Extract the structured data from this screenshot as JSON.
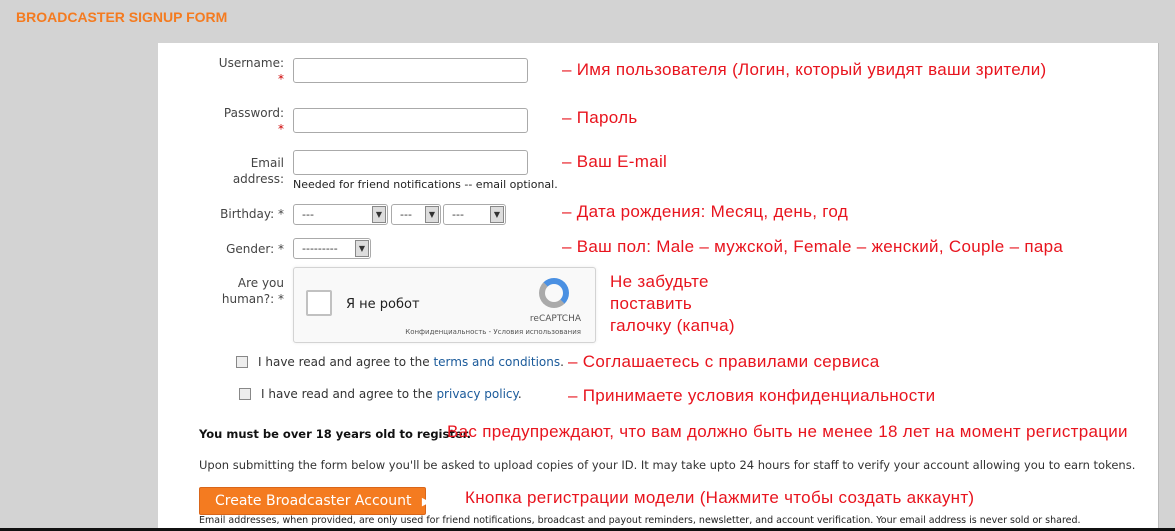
{
  "header": {
    "title": "BROADCASTER SIGNUP FORM"
  },
  "form": {
    "username": {
      "label": "Username:",
      "req": "*",
      "value": ""
    },
    "password": {
      "label": "Password:",
      "req": "*",
      "value": ""
    },
    "email": {
      "label1": "Email",
      "label2": "address:",
      "value": "",
      "hint": "Needed for friend notifications -- email optional."
    },
    "birthday": {
      "label": "Birthday: *",
      "month": "---",
      "day": "---",
      "year": "---"
    },
    "gender": {
      "label": "Gender: *",
      "value": "---------"
    },
    "human": {
      "label1": "Are you",
      "label2": "human?: *"
    },
    "captcha": {
      "text": "Я не робот",
      "brand": "reCAPTCHA",
      "links": "Конфиденциальность - Условия использования"
    },
    "terms": {
      "prefix": "I have read and agree to the ",
      "link": "terms and conditions",
      "suffix": "."
    },
    "privacy": {
      "prefix": "I have read and agree to the ",
      "link": "privacy policy",
      "suffix": "."
    },
    "age_warning": "You must be over 18 years old to register.",
    "upload_info": "Upon submitting the form below you'll be asked to upload copies of your ID. It may take upto 24 hours for staff to verify your account allowing you to earn tokens.",
    "submit_label": "Create Broadcaster Account",
    "disclaimer": "Email addresses, when provided, are only used for friend notifications, broadcast and payout reminders, newsletter, and account verification. Your email address is never sold or shared."
  },
  "annotations": {
    "username": "– Имя пользователя (Логин, который увидят ваши зрители)",
    "password": "– Пароль",
    "email": "– Ваш E-mail",
    "birthday": "– Дата рождения: Месяц, день, год",
    "gender": "– Ваш пол: Male – мужской, Female – женский, Couple – пара",
    "captcha1": "Не забудьте",
    "captcha2": "поставить",
    "captcha3": "галочку (капча)",
    "terms": "– Соглашаетесь с правилами сервиса",
    "privacy": "– Принимаете условия конфиденциальности",
    "age": "Вас предупреждают, что вам должно быть не менее 18 лет на момент регистрации",
    "button": "Кнопка регистрации модели (Нажмите чтобы создать аккаунт)"
  }
}
